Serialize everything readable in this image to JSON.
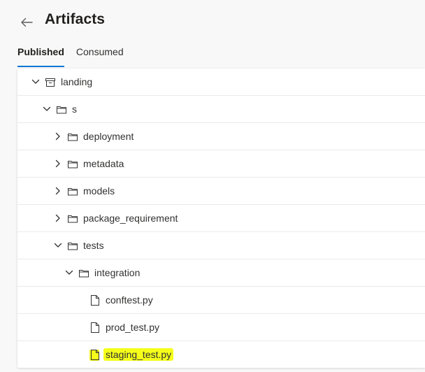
{
  "header": {
    "title": "Artifacts",
    "back_icon": "arrow-left-icon"
  },
  "tabs": [
    {
      "label": "Published",
      "active": true
    },
    {
      "label": "Consumed",
      "active": false
    }
  ],
  "tree": {
    "rows": [
      {
        "label": "landing",
        "icon": "package-icon",
        "chevron": "chevron-down-icon",
        "depth": 0
      },
      {
        "label": "s",
        "icon": "folder-icon",
        "chevron": "chevron-down-icon",
        "depth": 1
      },
      {
        "label": "deployment",
        "icon": "folder-icon",
        "chevron": "chevron-right-icon",
        "depth": 2
      },
      {
        "label": "metadata",
        "icon": "folder-icon",
        "chevron": "chevron-right-icon",
        "depth": 2
      },
      {
        "label": "models",
        "icon": "folder-icon",
        "chevron": "chevron-right-icon",
        "depth": 2
      },
      {
        "label": "package_requirement",
        "icon": "folder-icon",
        "chevron": "chevron-right-icon",
        "depth": 2
      },
      {
        "label": "tests",
        "icon": "folder-icon",
        "chevron": "chevron-down-icon",
        "depth": 2
      },
      {
        "label": "integration",
        "icon": "folder-icon",
        "chevron": "chevron-down-icon",
        "depth": 3
      },
      {
        "label": "conftest.py",
        "icon": "file-icon",
        "depth": 4
      },
      {
        "label": "prod_test.py",
        "icon": "file-icon",
        "depth": 4
      },
      {
        "label": "staging_test.py",
        "icon": "file-icon",
        "depth": 4,
        "highlighted": true
      }
    ]
  },
  "colors": {
    "accent": "#0078d4",
    "highlight": "#f5ff1a"
  }
}
